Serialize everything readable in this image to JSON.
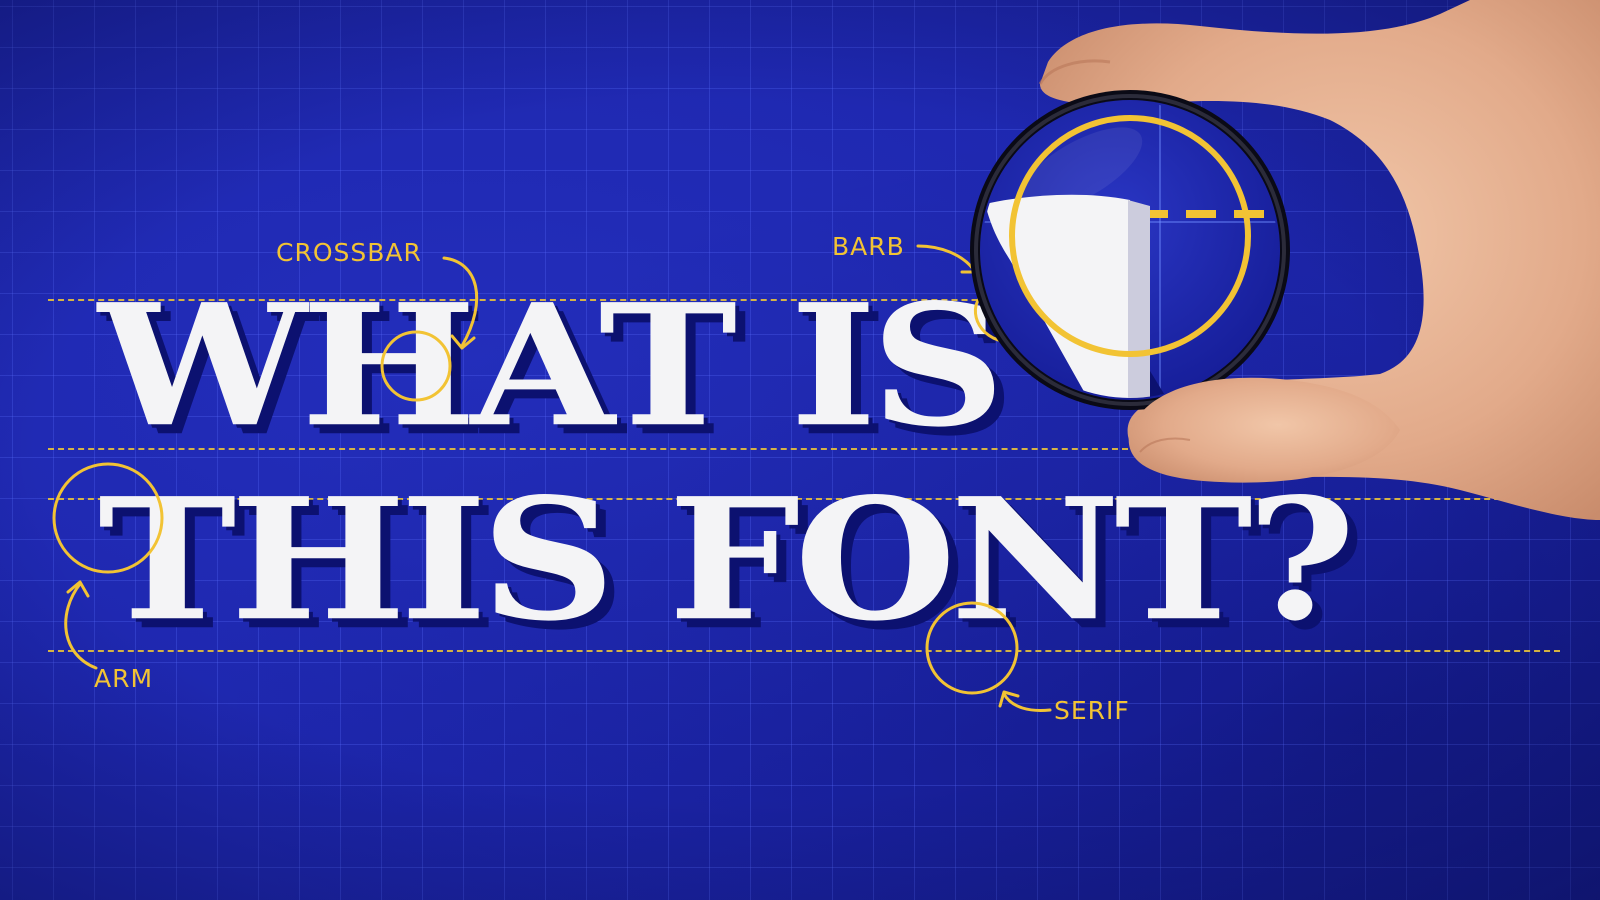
{
  "headline": {
    "line1": "WHAT IS",
    "line2": "THIS FONT?"
  },
  "annotations": {
    "crossbar": "CROSSBAR",
    "barb": "BARB",
    "arm": "ARM",
    "serif": "SERIF"
  },
  "colors": {
    "background": "#1d26ac",
    "accent": "#f2c334",
    "letters": "#f4f4f6",
    "letter_shadow": "#0c1170"
  },
  "icons": {
    "magnifier": "magnifying-glass-icon",
    "hand": "hand-icon"
  }
}
